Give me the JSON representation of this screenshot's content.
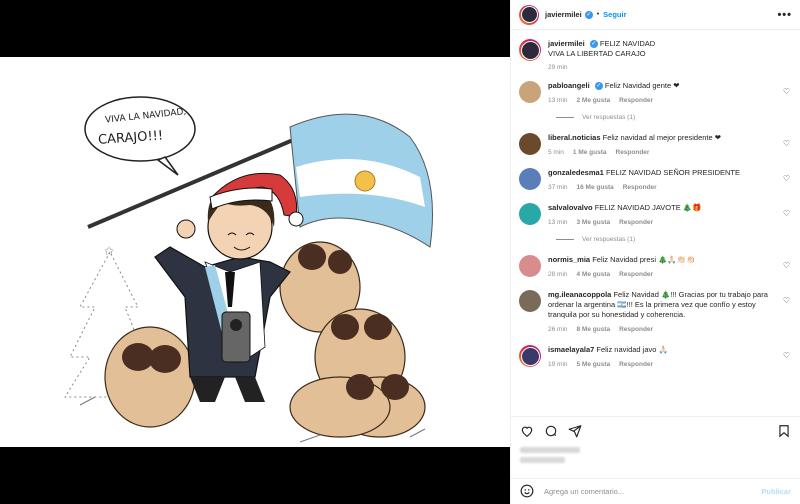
{
  "post": {
    "username": "javiermilei",
    "follow_label": "Seguir",
    "more_label": "•••",
    "separator": "•",
    "caption_line1": "FELIZ NAVIDAD",
    "caption_line2": "VIVA LA LIBERTAD CARAJO",
    "caption_time": "29 min"
  },
  "illustration": {
    "speech_line1": "VIVA LA NAVIDAD,",
    "speech_line2": "CARAJO!!!"
  },
  "comments": [
    {
      "user": "pabloangeli",
      "verified": true,
      "text": "Feliz Navidad gente ❤",
      "time": "13 min",
      "likes": "2 Me gusta",
      "reply": "Responder",
      "avatar_color": "#c9a37a",
      "view_replies": "Ver respuestas (1)"
    },
    {
      "user": "liberal.noticias",
      "verified": false,
      "text": "Feliz navidad al mejor presidente ❤",
      "time": "5 min",
      "likes": "1 Me gusta",
      "reply": "Responder",
      "avatar_color": "#6a4a2a"
    },
    {
      "user": "gonzaledesma1",
      "verified": false,
      "text": "FELIZ NAVIDAD SEÑOR PRESIDENTE",
      "time": "37 min",
      "likes": "16 Me gusta",
      "reply": "Responder",
      "avatar_color": "#5b7db8"
    },
    {
      "user": "salvalovalvo",
      "verified": false,
      "text": "FELIZ NAVIDAD JAVOTE 🎄🎁",
      "time": "13 min",
      "likes": "3 Me gusta",
      "reply": "Responder",
      "avatar_color": "#2aa8a8",
      "view_replies": "Ver respuestas (1)"
    },
    {
      "user": "normis_mia",
      "verified": false,
      "text": "Feliz Navidad presi 🎄🙏🏻👏🏻👏🏻",
      "time": "28 min",
      "likes": "4 Me gusta",
      "reply": "Responder",
      "avatar_color": "#d98c8c"
    },
    {
      "user": "mg.ileanacoppola",
      "verified": false,
      "text": "Feliz Navidad 🎄!!! Gracias por tu trabajo para ordenar la argentina 🇦🇷!!! Es la primera vez que confío y estoy tranquila por su honestidad y coherencia.",
      "time": "26 min",
      "likes": "8 Me gusta",
      "reply": "Responder",
      "avatar_color": "#7a6a5a"
    },
    {
      "user": "ismaelayala7",
      "verified": false,
      "text": "Feliz navidad javo 🙏🏻",
      "time": "19 min",
      "likes": "5 Me gusta",
      "reply": "Responder",
      "avatar_color": "#3a3a6a"
    }
  ],
  "add_comment": {
    "placeholder": "Agrega un comentario...",
    "publish_label": "Publicar"
  },
  "icons": [
    "heart-icon",
    "comment-icon",
    "share-icon",
    "bookmark-icon",
    "emoji-icon",
    "more-icon",
    "verified-icon"
  ],
  "colors": {
    "accent": "#0095f6",
    "muted": "#8e8e8e",
    "heart": "#e0245e"
  }
}
